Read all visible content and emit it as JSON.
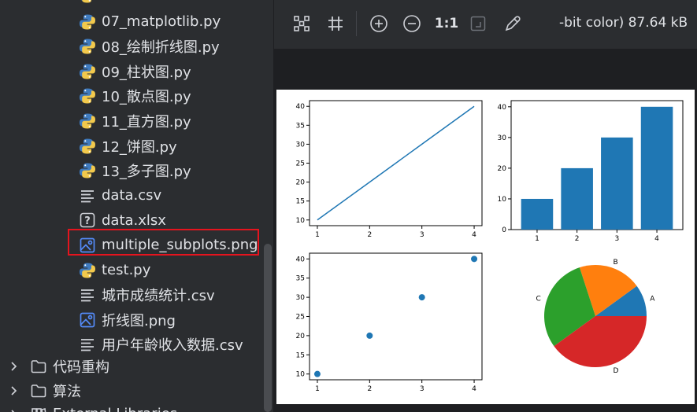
{
  "file_tree": {
    "items": [
      {
        "label": "07_matplotlib.py",
        "icon": "python-file-icon"
      },
      {
        "label": "08_绘制折线图.py",
        "icon": "python-file-icon"
      },
      {
        "label": "09_柱状图.py",
        "icon": "python-file-icon"
      },
      {
        "label": "10_散点图.py",
        "icon": "python-file-icon"
      },
      {
        "label": "11_直方图.py",
        "icon": "python-file-icon"
      },
      {
        "label": "12_饼图.py",
        "icon": "python-file-icon"
      },
      {
        "label": "13_多子图.py",
        "icon": "python-file-icon"
      },
      {
        "label": "data.csv",
        "icon": "text-file-icon"
      },
      {
        "label": "data.xlsx",
        "icon": "unknown-file-icon"
      },
      {
        "label": "multiple_subplots.png",
        "icon": "image-file-icon",
        "selected": true
      },
      {
        "label": "test.py",
        "icon": "python-file-icon"
      },
      {
        "label": "城市成绩统计.csv",
        "icon": "text-file-icon"
      },
      {
        "label": "折线图.png",
        "icon": "image-file-icon"
      },
      {
        "label": "用户年龄收入数据.csv",
        "icon": "text-file-icon"
      }
    ],
    "folders": [
      {
        "label": "代码重构",
        "icon": "folder-icon",
        "expanded": false
      },
      {
        "label": "算法",
        "icon": "folder-icon",
        "expanded": false
      }
    ],
    "partial_bottom": "External Libraries",
    "highlight_color": "#e5141e"
  },
  "viewer": {
    "toolbar": {
      "fit_icon": "fit-to-screen-icon",
      "grid_icon": "grid-icon",
      "zoom_in_icon": "zoom-in-icon",
      "zoom_out_icon": "zoom-out-icon",
      "actual_size_label": "1:1",
      "background_icon": "background-toggle-icon",
      "color_picker_icon": "color-picker-icon"
    },
    "image_info": "-bit color) 87.64 kB"
  },
  "chart_data": [
    {
      "type": "line",
      "x": [
        1,
        2,
        3,
        4
      ],
      "y": [
        10,
        20,
        30,
        40
      ],
      "xticks": [
        "1",
        "2",
        "3",
        "4"
      ],
      "yticks": [
        "10",
        "15",
        "20",
        "25",
        "30",
        "35",
        "40"
      ],
      "xlim": [
        0.85,
        4.15
      ],
      "ylim": [
        8.5,
        41.5
      ],
      "color": "#1f77b4"
    },
    {
      "type": "bar",
      "categories": [
        "1",
        "2",
        "3",
        "4"
      ],
      "values": [
        10,
        20,
        30,
        40
      ],
      "yticks": [
        "0",
        "10",
        "20",
        "30",
        "40"
      ],
      "ylim": [
        0,
        42
      ],
      "color": "#1f77b4"
    },
    {
      "type": "scatter",
      "x": [
        1,
        2,
        3,
        4
      ],
      "y": [
        10,
        20,
        30,
        40
      ],
      "xticks": [
        "1",
        "2",
        "3",
        "4"
      ],
      "yticks": [
        "10",
        "15",
        "20",
        "25",
        "30",
        "35",
        "40"
      ],
      "xlim": [
        0.85,
        4.15
      ],
      "ylim": [
        8.5,
        41.5
      ],
      "color": "#1f77b4"
    },
    {
      "type": "pie",
      "labels": [
        "A",
        "B",
        "C",
        "D"
      ],
      "values": [
        10,
        20,
        30,
        40
      ],
      "colors": [
        "#1f77b4",
        "#ff7f0e",
        "#2ca02c",
        "#d62728"
      ]
    }
  ]
}
